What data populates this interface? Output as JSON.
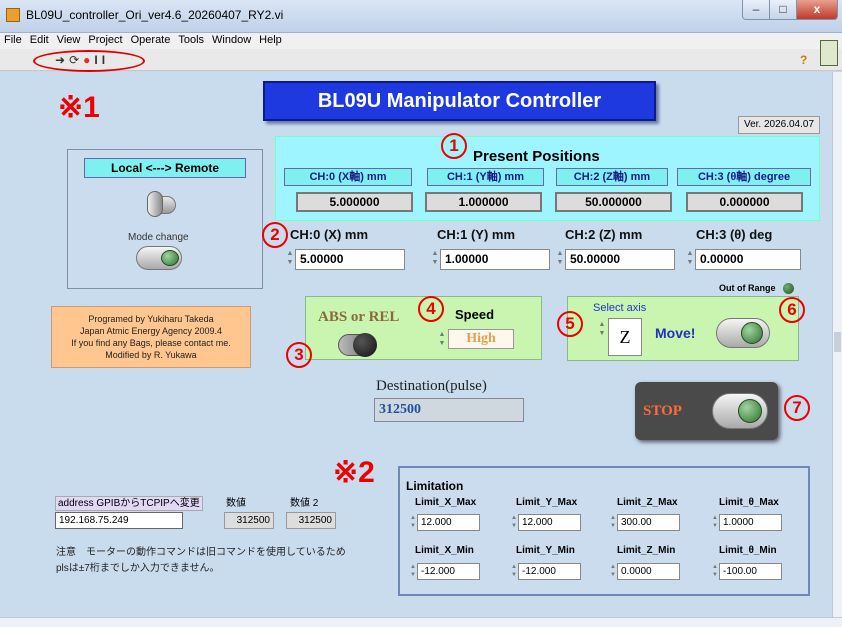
{
  "window": {
    "title": "BL09U_controller_Ori_ver4.6_20260407_RY2.vi",
    "minimize": "–",
    "maximize": "□",
    "close": "x"
  },
  "menu": [
    "File",
    "Edit",
    "View",
    "Project",
    "Operate",
    "Tools",
    "Window",
    "Help"
  ],
  "toolbar": {
    "icons": [
      "run-arrow-icon",
      "run-continuous-icon",
      "abort-icon",
      "pause-icon"
    ],
    "run": "➜",
    "run_cont": "⟳",
    "abort": "●",
    "pause": "II",
    "help": "?"
  },
  "annotations": {
    "note1": "※1",
    "note2": "※2",
    "c1": "1",
    "c2": "2",
    "c3": "3",
    "c4": "4",
    "c5": "5",
    "c6": "6",
    "c7": "7",
    "color": "#ee0000"
  },
  "header": {
    "title": "BL09U Manipulator Controller",
    "version": "Ver. 2026.04.07"
  },
  "local_remote": {
    "label": "Local <---> Remote",
    "mode_change": "Mode change"
  },
  "present_positions": {
    "title": "Present Positions",
    "channels": [
      {
        "label": "CH:0 (X軸) mm",
        "value": "5.000000"
      },
      {
        "label": "CH:1 (Y軸) mm",
        "value": "1.000000"
      },
      {
        "label": "CH:2 (Z軸) mm",
        "value": "50.000000"
      },
      {
        "label": "CH:3 (θ軸) degree",
        "value": "0.000000"
      }
    ]
  },
  "targets": [
    {
      "label": "CH:0 (X) mm",
      "value": "5.00000"
    },
    {
      "label": "CH:1 (Y) mm",
      "value": "1.00000"
    },
    {
      "label": "CH:2 (Z) mm",
      "value": "50.00000"
    },
    {
      "label": "CH:3 (θ) deg",
      "value": "0.00000"
    }
  ],
  "credit": [
    "Programed by Yukiharu Takeda",
    "Japan Atmic Energy Agency 2009.4",
    "If you find  any Bags, please contact me.",
    "Modified by R. Yukawa"
  ],
  "motion": {
    "abs_rel": "ABS or REL",
    "speed_label": "Speed",
    "speed_value": "High",
    "destination_label": "Destination(pulse)",
    "destination_value": "312500",
    "out_of_range": "Out of Range",
    "select_axis": "Select axis",
    "axis_value": "Z",
    "move": "Move!",
    "stop": "STOP"
  },
  "address": {
    "label": "address GPIBからTCPIPへ変更",
    "value": "192.168.75.249",
    "num_label": "数値",
    "num_value": "312500",
    "num2_label": "数値 2",
    "num2_value": "312500",
    "note_line1": "注意　モーターの動作コマンドは旧コマンドを使用しているため",
    "note_line2": "plsは±7桁までしか入力できません。"
  },
  "limitation": {
    "title": "Limitation",
    "max": [
      {
        "label": "Limit_X_Max",
        "value": "12.000"
      },
      {
        "label": "Limit_Y_Max",
        "value": "12.000"
      },
      {
        "label": "Limit_Z_Max",
        "value": "300.00"
      },
      {
        "label": "Limit_θ_Max",
        "value": "1.0000"
      }
    ],
    "min": [
      {
        "label": "Limit_X_Min",
        "value": "-12.000"
      },
      {
        "label": "Limit_Y_Min",
        "value": "-12.000"
      },
      {
        "label": "Limit_Z_Min",
        "value": "0.0000"
      },
      {
        "label": "Limit_θ_Min",
        "value": "-100.00"
      }
    ]
  }
}
